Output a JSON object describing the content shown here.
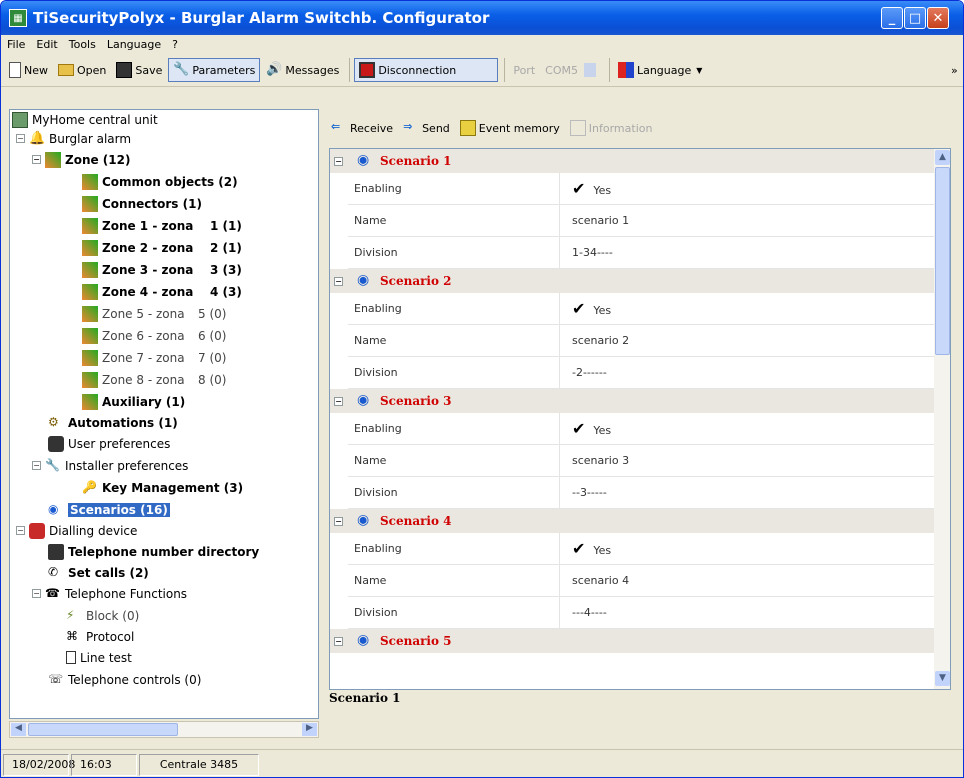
{
  "window": {
    "title": "TiSecurityPolyx - Burglar Alarm Switchb. Configurator",
    "min": "_",
    "max": "□",
    "close": "✕"
  },
  "menu": [
    "File",
    "Edit",
    "Tools",
    "Language",
    "?"
  ],
  "toolbar": {
    "new": "New",
    "open": "Open",
    "save": "Save",
    "parameters": "Parameters",
    "messages": "Messages",
    "disconnection": "Disconnection",
    "port": "Port",
    "com": "COM5",
    "language": "Language",
    "overflow": "»"
  },
  "tree": {
    "root": "MyHome central unit",
    "burglar": "Burglar alarm",
    "zone": "Zone (12)",
    "common": "Common objects (2)",
    "connectors": "Connectors (1)",
    "zones": [
      {
        "name": "Zone 1 - zona",
        "count": "1 (1)"
      },
      {
        "name": "Zone 2 - zona",
        "count": "2 (1)"
      },
      {
        "name": "Zone 3 - zona",
        "count": "3 (3)"
      },
      {
        "name": "Zone 4 - zona",
        "count": "4 (3)"
      },
      {
        "name": "Zone 5 - zona",
        "count": "5 (0)"
      },
      {
        "name": "Zone 6 - zona",
        "count": "6 (0)"
      },
      {
        "name": "Zone 7 - zona",
        "count": "7 (0)"
      },
      {
        "name": "Zone 8 - zona",
        "count": "8 (0)"
      }
    ],
    "auxiliary": "Auxiliary (1)",
    "automations": "Automations (1)",
    "user_prefs": "User preferences",
    "installer_prefs": "Installer preferences",
    "key_mgmt": "Key Management (3)",
    "scenarios": "Scenarios (16)",
    "dialling": "Dialling device",
    "phonebook": "Telephone number directory",
    "set_calls": "Set calls (2)",
    "tel_functions": "Telephone Functions",
    "block": "Block (0)",
    "protocol": "Protocol",
    "line_test": "Line test",
    "tel_controls": "Telephone controls (0)"
  },
  "right_toolbar": {
    "receive": "Receive",
    "send": "Send",
    "event_memory": "Event memory",
    "information": "Information"
  },
  "scenarios": [
    {
      "title": "Scenario 1",
      "enabling_label": "Enabling",
      "enabling": "Yes",
      "name_label": "Name",
      "name": "scenario  1",
      "division_label": "Division",
      "division": "1-34----"
    },
    {
      "title": "Scenario 2",
      "enabling_label": "Enabling",
      "enabling": "Yes",
      "name_label": "Name",
      "name": "scenario  2",
      "division_label": "Division",
      "division": "-2------"
    },
    {
      "title": "Scenario 3",
      "enabling_label": "Enabling",
      "enabling": "Yes",
      "name_label": "Name",
      "name": "scenario  3",
      "division_label": "Division",
      "division": "--3-----"
    },
    {
      "title": "Scenario 4",
      "enabling_label": "Enabling",
      "enabling": "Yes",
      "name_label": "Name",
      "name": "scenario  4",
      "division_label": "Division",
      "division": "---4----"
    },
    {
      "title": "Scenario 5"
    }
  ],
  "caption": "Scenario 1",
  "status": {
    "date": "18/02/2008",
    "time": "16:03",
    "unit": "Centrale 3485"
  },
  "colors": {
    "title_bar": "#0b4fd4",
    "scenario_title": "#d00000",
    "selection": "#316ac5"
  }
}
